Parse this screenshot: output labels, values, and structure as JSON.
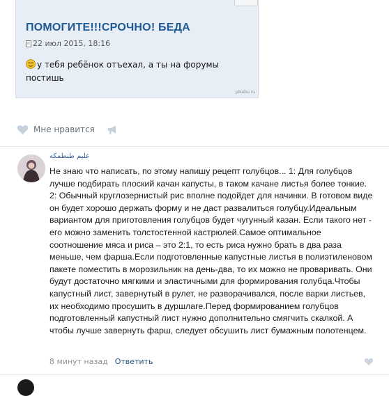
{
  "embed": {
    "title": "ПОМОГИТЕ!!!СРОЧНО! БЕДА",
    "date": "22 июл 2015, 18:16",
    "message": "у тебя ребёнок отъехал, а ты на форумы постишь",
    "watermark": "pikabu.ru"
  },
  "post_actions": {
    "like_label": "Мне нравится",
    "like_icon": "heart-icon",
    "share_icon": "megaphone-icon"
  },
  "comment": {
    "author": "عليم طنطمكه",
    "text": "Не знаю что написать, по этому напишу рецепт голубцов... 1: Для голубцов лучше подбирать плоский качан капусты, в таком качане листья более тонкие. 2: Обычный круглозернистый рис вполне подойдет для начинки. В готовом виде он будет хорошо держать форму и не даст развалиться голубцу.Идеальным вариантом для приготовления голубцов будет чугунный казан. Если такого нет - его можно заменить толстостенной кастрюлей.Самое оптимальное соотношение мяса и риса – это 2:1, то есть риса нужно брать в два раза меньше, чем фарша.Если подготовленные капустные листья в полиэтиленовом пакете поместить в морозильник на день-два, то их можно не проваривать. Они будут достаточно мягкими и эластичными для формирования голубца.Чтобы капустный лист, завернутый в рулет, не разворачивался, после варки листьев, их необходимо просушить в дуршлаге.Перед формированием голубцов подготовленный капустный лист нужно дополнительно смягчить скалкой. А чтобы лучше завернуть фарш, следует обсушить лист бумажным полотенцем.",
    "time": "8 минут назад",
    "reply_label": "Ответить"
  },
  "colors": {
    "link": "#2a5885",
    "embed_bg": "#e8eef5",
    "embed_title": "#1e5a96",
    "muted": "#8a939c"
  }
}
